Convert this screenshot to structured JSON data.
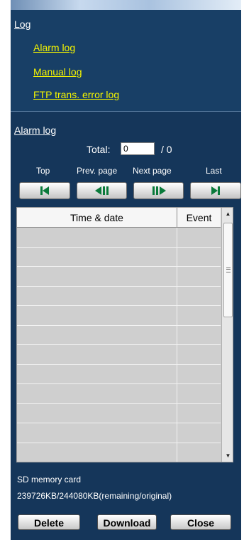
{
  "log_section": {
    "title": "Log",
    "links": [
      "Alarm log",
      "Manual log",
      "FTP trans. error log"
    ]
  },
  "alarm_log": {
    "title": "Alarm log",
    "total_label": "Total:",
    "total_value": "0",
    "total_of": "/ 0",
    "nav": {
      "top": "Top",
      "prev": "Prev. page",
      "next": "Next page",
      "last": "Last"
    },
    "table": {
      "columns": [
        "Time & date",
        "Event"
      ],
      "rows": [
        [
          "",
          ""
        ],
        [
          "",
          ""
        ],
        [
          "",
          ""
        ],
        [
          "",
          ""
        ],
        [
          "",
          ""
        ],
        [
          "",
          ""
        ],
        [
          "",
          ""
        ],
        [
          "",
          ""
        ],
        [
          "",
          ""
        ],
        [
          "",
          ""
        ],
        [
          "",
          ""
        ],
        [
          "",
          ""
        ]
      ]
    }
  },
  "sd_card": {
    "label": "SD memory card",
    "capacity": "239726KB/244080KB(remaining/original)"
  },
  "buttons": {
    "delete": "Delete",
    "download": "Download",
    "close": "Close"
  },
  "colors": {
    "panel_bg": "#15365a",
    "link_yellow": "#f4f400",
    "arrow_green": "#0a7a3a"
  },
  "icons": {
    "top": "skip-to-first-icon",
    "prev": "previous-page-icon",
    "next": "next-page-icon",
    "last": "skip-to-last-icon"
  }
}
